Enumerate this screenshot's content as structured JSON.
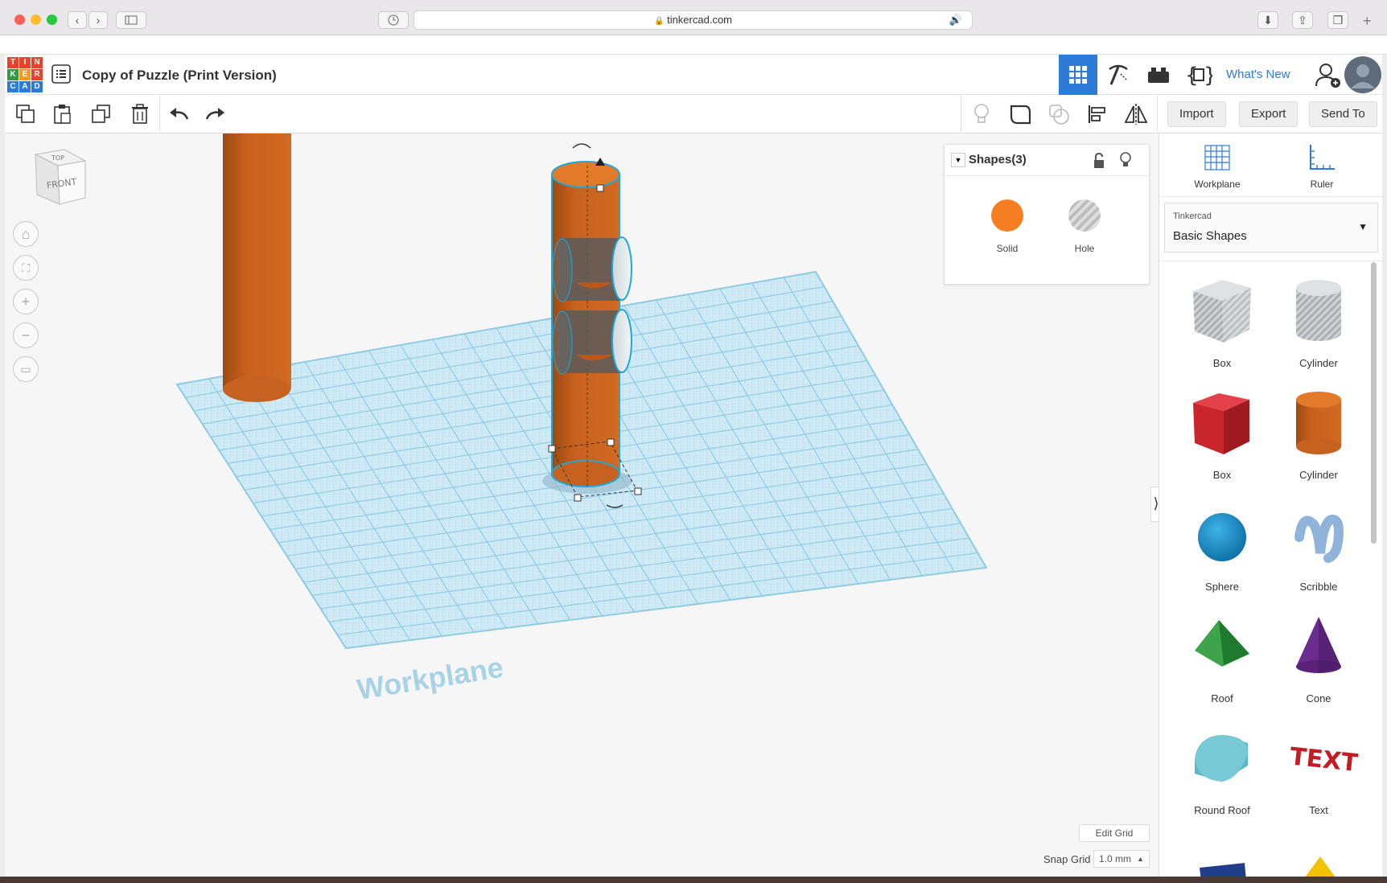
{
  "browser": {
    "url": "tinkercad.com",
    "back_icon": "chevron-left-icon",
    "forward_icon": "chevron-right-icon"
  },
  "app": {
    "logo_letters": [
      "T",
      "I",
      "N",
      "K",
      "E",
      "R",
      "C",
      "A",
      "D"
    ],
    "logo_colors": [
      "#e3442b",
      "#e3442b",
      "#e3442b",
      "#2d9a47",
      "#f79a1c",
      "#e3442b",
      "#2d7bd9",
      "#2d7bd9",
      "#2d7bd9"
    ],
    "title": "Copy of Puzzle (Print Version)",
    "whats_new": "What's New"
  },
  "toolbar": {
    "import": "Import",
    "export": "Export",
    "send_to": "Send To"
  },
  "viewcube": {
    "top": "TOP",
    "front": "FRONT"
  },
  "workplane_label": "Workplane",
  "inspector": {
    "title": "Shapes(3)",
    "solid": "Solid",
    "hole": "Hole",
    "solid_color": "#f57f20"
  },
  "panel": {
    "workplane": "Workplane",
    "ruler": "Ruler",
    "library_vendor": "Tinkercad",
    "library_name": "Basic Shapes",
    "shapes": [
      {
        "label": "Box"
      },
      {
        "label": "Cylinder"
      },
      {
        "label": "Box"
      },
      {
        "label": "Cylinder"
      },
      {
        "label": "Sphere"
      },
      {
        "label": "Scribble"
      },
      {
        "label": "Roof"
      },
      {
        "label": "Cone"
      },
      {
        "label": "Round Roof"
      },
      {
        "label": "Text"
      }
    ]
  },
  "bottom": {
    "edit_grid": "Edit Grid",
    "snap_grid_label": "Snap Grid",
    "snap_grid_value": "1.0 mm"
  }
}
